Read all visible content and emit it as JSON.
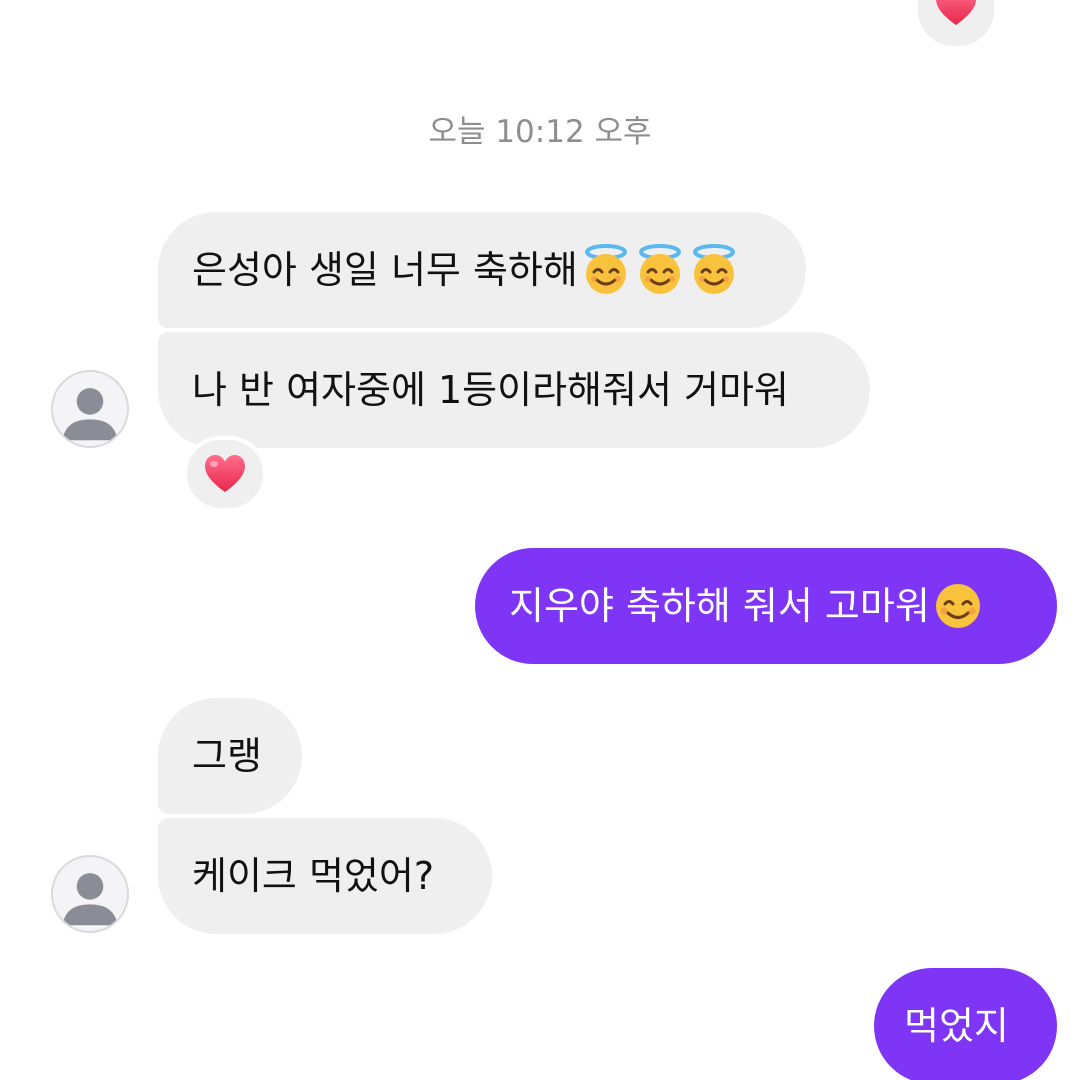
{
  "conversation": {
    "timestamp": "오늘 10:12 오후",
    "messages": [
      {
        "from": "other",
        "text": "은성아 생일 너무 축하해",
        "emoji": [
          "smiling-face-with-halo",
          "smiling-face-with-halo",
          "smiling-face-with-halo"
        ]
      },
      {
        "from": "other",
        "text": "나 반 여자중에 1등이라해줘서 거마워",
        "reaction": "red-heart"
      },
      {
        "from": "me",
        "text": "지우야 축하해 줘서 고마워",
        "emoji": [
          "smiling-face-with-smiling-eyes"
        ]
      },
      {
        "from": "other",
        "text": "그랭"
      },
      {
        "from": "other",
        "text": "케이크 먹었어?"
      },
      {
        "from": "me",
        "text": "먹었지"
      }
    ],
    "top_reaction": "red-heart"
  },
  "colors": {
    "outgoing_bubble": "#7f35f5",
    "incoming_bubble": "#efefef",
    "timestamp_text": "#8e8e8e",
    "heart": "#f0405f"
  }
}
